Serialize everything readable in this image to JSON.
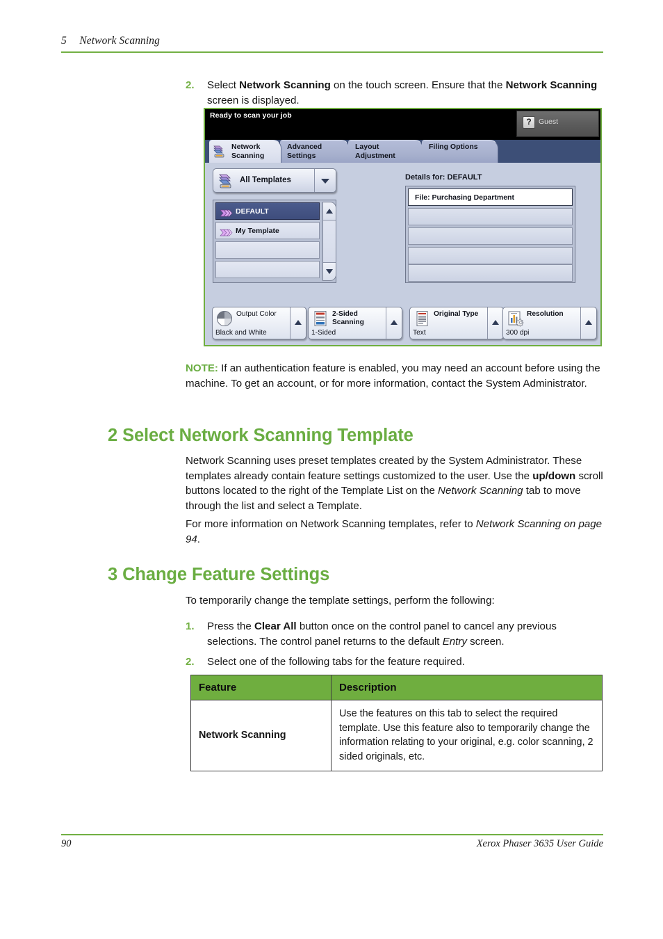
{
  "page": {
    "chapter_number": "5",
    "chapter_title": "Network Scanning",
    "page_number": "90",
    "guide_title": "Xerox Phaser 3635 User Guide",
    "accent_green": "#72b043",
    "heading_green": "#6aad42"
  },
  "step2": {
    "number": "2.",
    "text_part1": "Select ",
    "bold1": "Network Scanning",
    "text_part2": " on the touch screen. Ensure that the ",
    "bold2": "Network Scanning",
    "text_part3": " screen is displayed."
  },
  "touchscreen": {
    "status_text": "Ready to scan your job",
    "guest_label": "Guest",
    "guest_icon": "question-mark-icon",
    "tabs": [
      {
        "label": "Network\nScanning",
        "active": true,
        "icon": "network-scanning-icon"
      },
      {
        "label": "Advanced\nSettings",
        "active": false
      },
      {
        "label": "Layout\nAdjustment",
        "active": false
      },
      {
        "label": "Filing Options",
        "active": false
      }
    ],
    "dropdown": {
      "label": "All Templates",
      "icon": "network-scanning-icon",
      "arrow_icon": "chevron-down-icon"
    },
    "template_list": [
      {
        "label": "DEFAULT",
        "selected": true,
        "icon": "template-chevron-icon"
      },
      {
        "label": "My Template",
        "selected": false,
        "icon": "template-chevron-icon"
      },
      {
        "label": "",
        "selected": false
      },
      {
        "label": "",
        "selected": false
      }
    ],
    "scroll": {
      "up_icon": "triangle-up-icon",
      "down_icon": "triangle-down-icon"
    },
    "details_title": "Details for: DEFAULT",
    "details_rows": [
      {
        "label": "File: Purchasing Department"
      },
      {
        "label": ""
      },
      {
        "label": ""
      },
      {
        "label": ""
      },
      {
        "label": ""
      }
    ],
    "features": [
      {
        "title": "Output Color",
        "value": "Black and White",
        "icon": "color-wheel-icon",
        "bold_title": false
      },
      {
        "title": "2-Sided\nScanning",
        "value": "1-Sided",
        "icon": "two-sided-scanning-icon",
        "bold_title": true
      },
      {
        "title": "Original Type",
        "value": "Text",
        "icon": "document-text-icon",
        "bold_title": true
      },
      {
        "title": "Resolution",
        "value": "300 dpi",
        "icon": "resolution-gear-icon",
        "bold_title": true
      }
    ]
  },
  "note": {
    "label": "NOTE:",
    "text": " If an authentication feature is enabled, you may need an account before using the machine. To get an account, or for more information, contact the System Administrator."
  },
  "section2": {
    "heading": "2 Select Network Scanning Template",
    "para1_a": "Network Scanning uses preset templates created by the System Administrator. These templates already contain feature settings customized to the user. Use the ",
    "para1_bold": "up/down",
    "para1_b": " scroll buttons located to the right of the Template List on the ",
    "para1_italic1": "Network Scanning",
    "para1_c": " tab to move through the list and select a Template.",
    "para2_a": "For more information on Network Scanning templates, refer to ",
    "para2_italic": "Network Scanning on page 94",
    "para2_b": "."
  },
  "section3": {
    "heading": "3 Change Feature Settings",
    "intro": "To temporarily change the template settings, perform the following:",
    "steps": [
      {
        "number": "1.",
        "a": "Press the ",
        "bold": "Clear All",
        "b": " button once on the control panel to cancel any previous selections.  The control panel returns to the default ",
        "italic": "Entry",
        "c": " screen."
      },
      {
        "number": "2.",
        "a": "Select one of the following tabs for the feature required.",
        "bold": "",
        "b": "",
        "italic": "",
        "c": ""
      }
    ]
  },
  "table": {
    "headers": [
      "Feature",
      "Description"
    ],
    "rows": [
      {
        "feature": "Network Scanning",
        "description": "Use the features on this tab to select the required template. Use this feature also to temporarily change the information relating to your original, e.g. color scanning, 2 sided originals, etc."
      }
    ]
  }
}
